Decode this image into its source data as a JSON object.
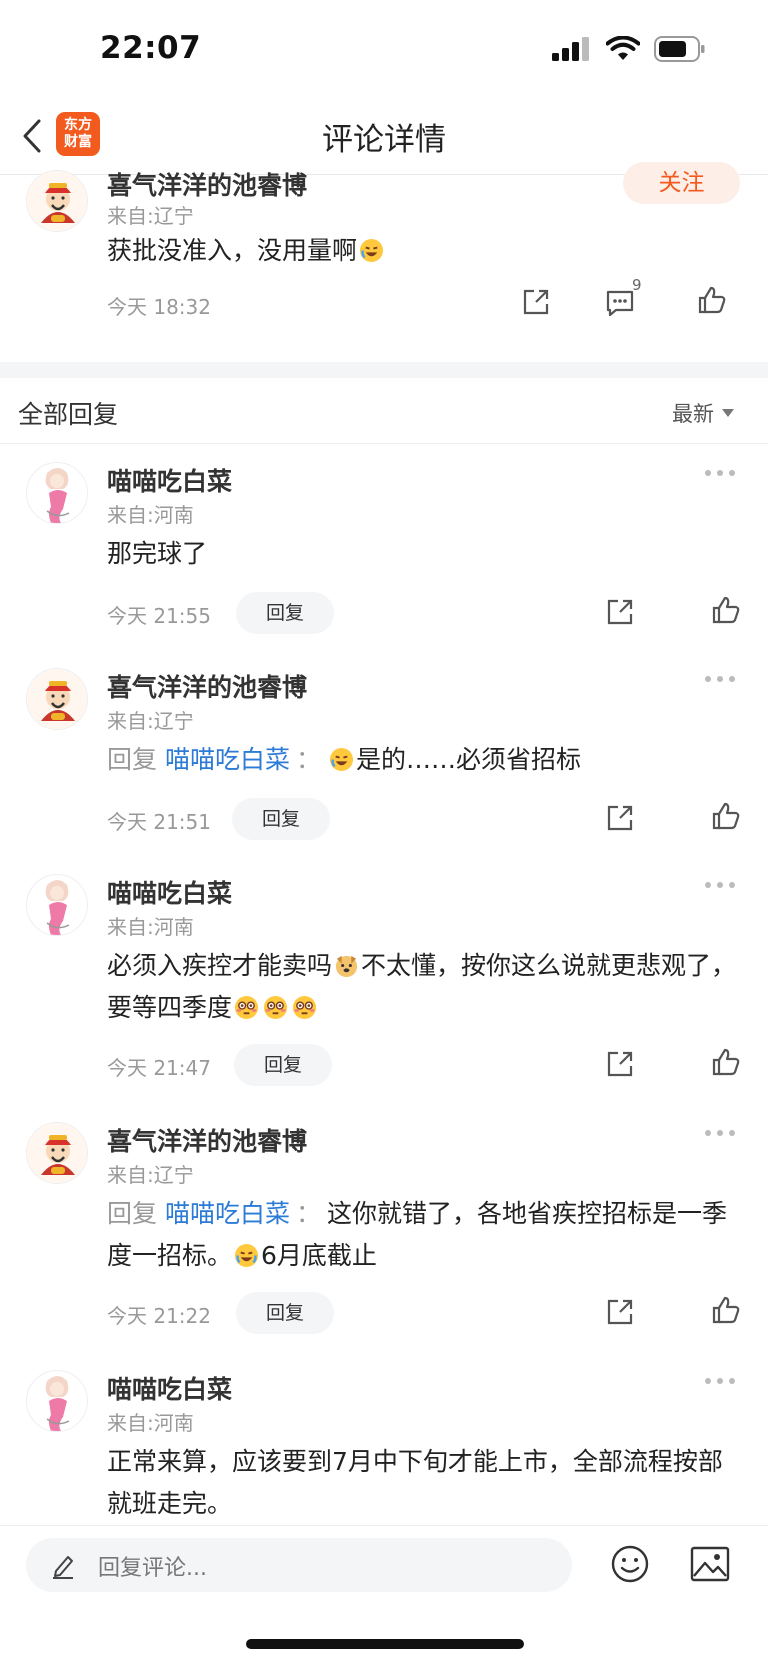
{
  "status_bar": {
    "time": "22:07"
  },
  "nav": {
    "title": "评论详情",
    "logo_line1": "东方",
    "logo_line2": "财富"
  },
  "main_comment": {
    "username": "喜气洋洋的池睿博",
    "location": "来自:辽宁",
    "text": "获批没准入，没用量啊",
    "time": "今天 18:32",
    "follow_label": "关注",
    "comment_count": "9"
  },
  "replies_section": {
    "title": "全部回复",
    "sort_label": "最新"
  },
  "replies": [
    {
      "username": "喵喵吃白菜",
      "location": "来自:河南",
      "text": "那完球了",
      "time": "今天 21:55",
      "reply_label": "回复"
    },
    {
      "username": "喜气洋洋的池睿博",
      "location": "来自:辽宁",
      "mention_prefix": "回复",
      "mention_name": "喵喵吃白菜",
      "colon": "：",
      "text": "是的……必须省招标",
      "time": "今天 21:51",
      "reply_label": "回复"
    },
    {
      "username": "喵喵吃白菜",
      "location": "来自:河南",
      "text_a": "必须入疾控才能卖吗",
      "text_b": "不太懂，按你这么说就更悲观了，要等四季度",
      "time": "今天 21:47",
      "reply_label": "回复"
    },
    {
      "username": "喜气洋洋的池睿博",
      "location": "来自:辽宁",
      "mention_prefix": "回复",
      "mention_name": "喵喵吃白菜",
      "colon": "：",
      "text_a": "这你就错了，各地省疾控招标是一季度一招标。",
      "text_b": "6月底截止",
      "time": "今天 21:22",
      "reply_label": "回复"
    },
    {
      "username": "喵喵吃白菜",
      "location": "来自:河南",
      "text": "正常来算，应该要到7月中下旬才能上市，全部流程按部就班走完。"
    }
  ],
  "bottom_bar": {
    "input_placeholder": "回复评论..."
  }
}
